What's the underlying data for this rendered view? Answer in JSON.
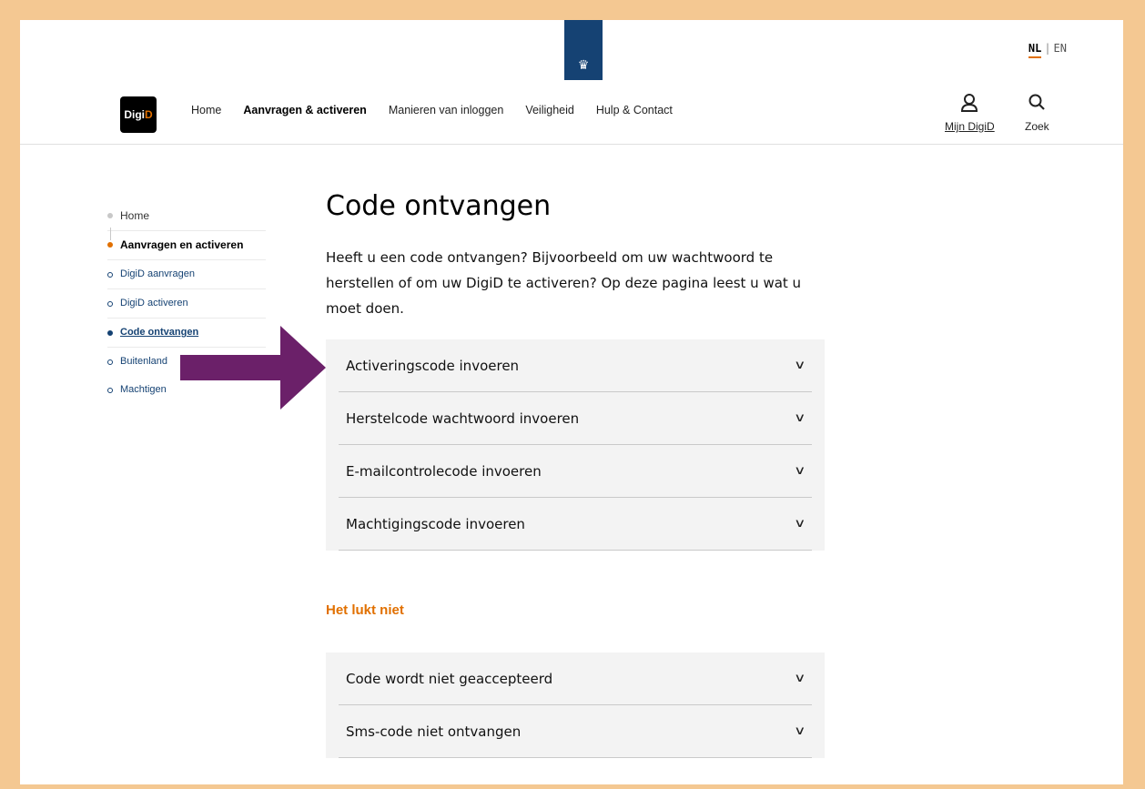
{
  "header": {
    "lang_active": "NL",
    "lang_separator": "|",
    "lang_other": "EN",
    "logo_text_a": "Digi",
    "logo_text_b": "D",
    "nav": [
      "Home",
      "Aanvragen & activeren",
      "Manieren van inloggen",
      "Veiligheid",
      "Hulp & Contact"
    ],
    "nav_active_index": 1,
    "mijn_digid": "Mijn DigiD",
    "zoek": "Zoek"
  },
  "sidebar": {
    "home": "Home",
    "section": "Aanvragen en activeren",
    "items": [
      "DigiD aanvragen",
      "DigiD activeren",
      "Code ontvangen",
      "Buitenland",
      "Machtigen"
    ],
    "current_index": 2
  },
  "main": {
    "title": "Code ontvangen",
    "intro": "Heeft u een code ontvangen? Bijvoorbeeld om uw wachtwoord te herstellen of om uw DigiD te activeren? Op deze pagina leest u wat u moet doen.",
    "accordion": [
      "Activeringscode invoeren",
      "Herstelcode wachtwoord invoeren",
      "E-mailcontrolecode invoeren",
      "Machtigingscode invoeren"
    ],
    "subheading": "Het lukt niet",
    "accordion2": [
      "Code wordt niet geaccepteerd",
      "Sms-code niet ontvangen"
    ]
  },
  "colors": {
    "frame": "#f4c892",
    "brand_blue": "#154273",
    "accent_orange": "#e17000",
    "arrow_purple": "#6b2069"
  },
  "icons": {
    "user": "user-icon",
    "search": "search-icon",
    "chevron": "chevron-down-icon"
  }
}
